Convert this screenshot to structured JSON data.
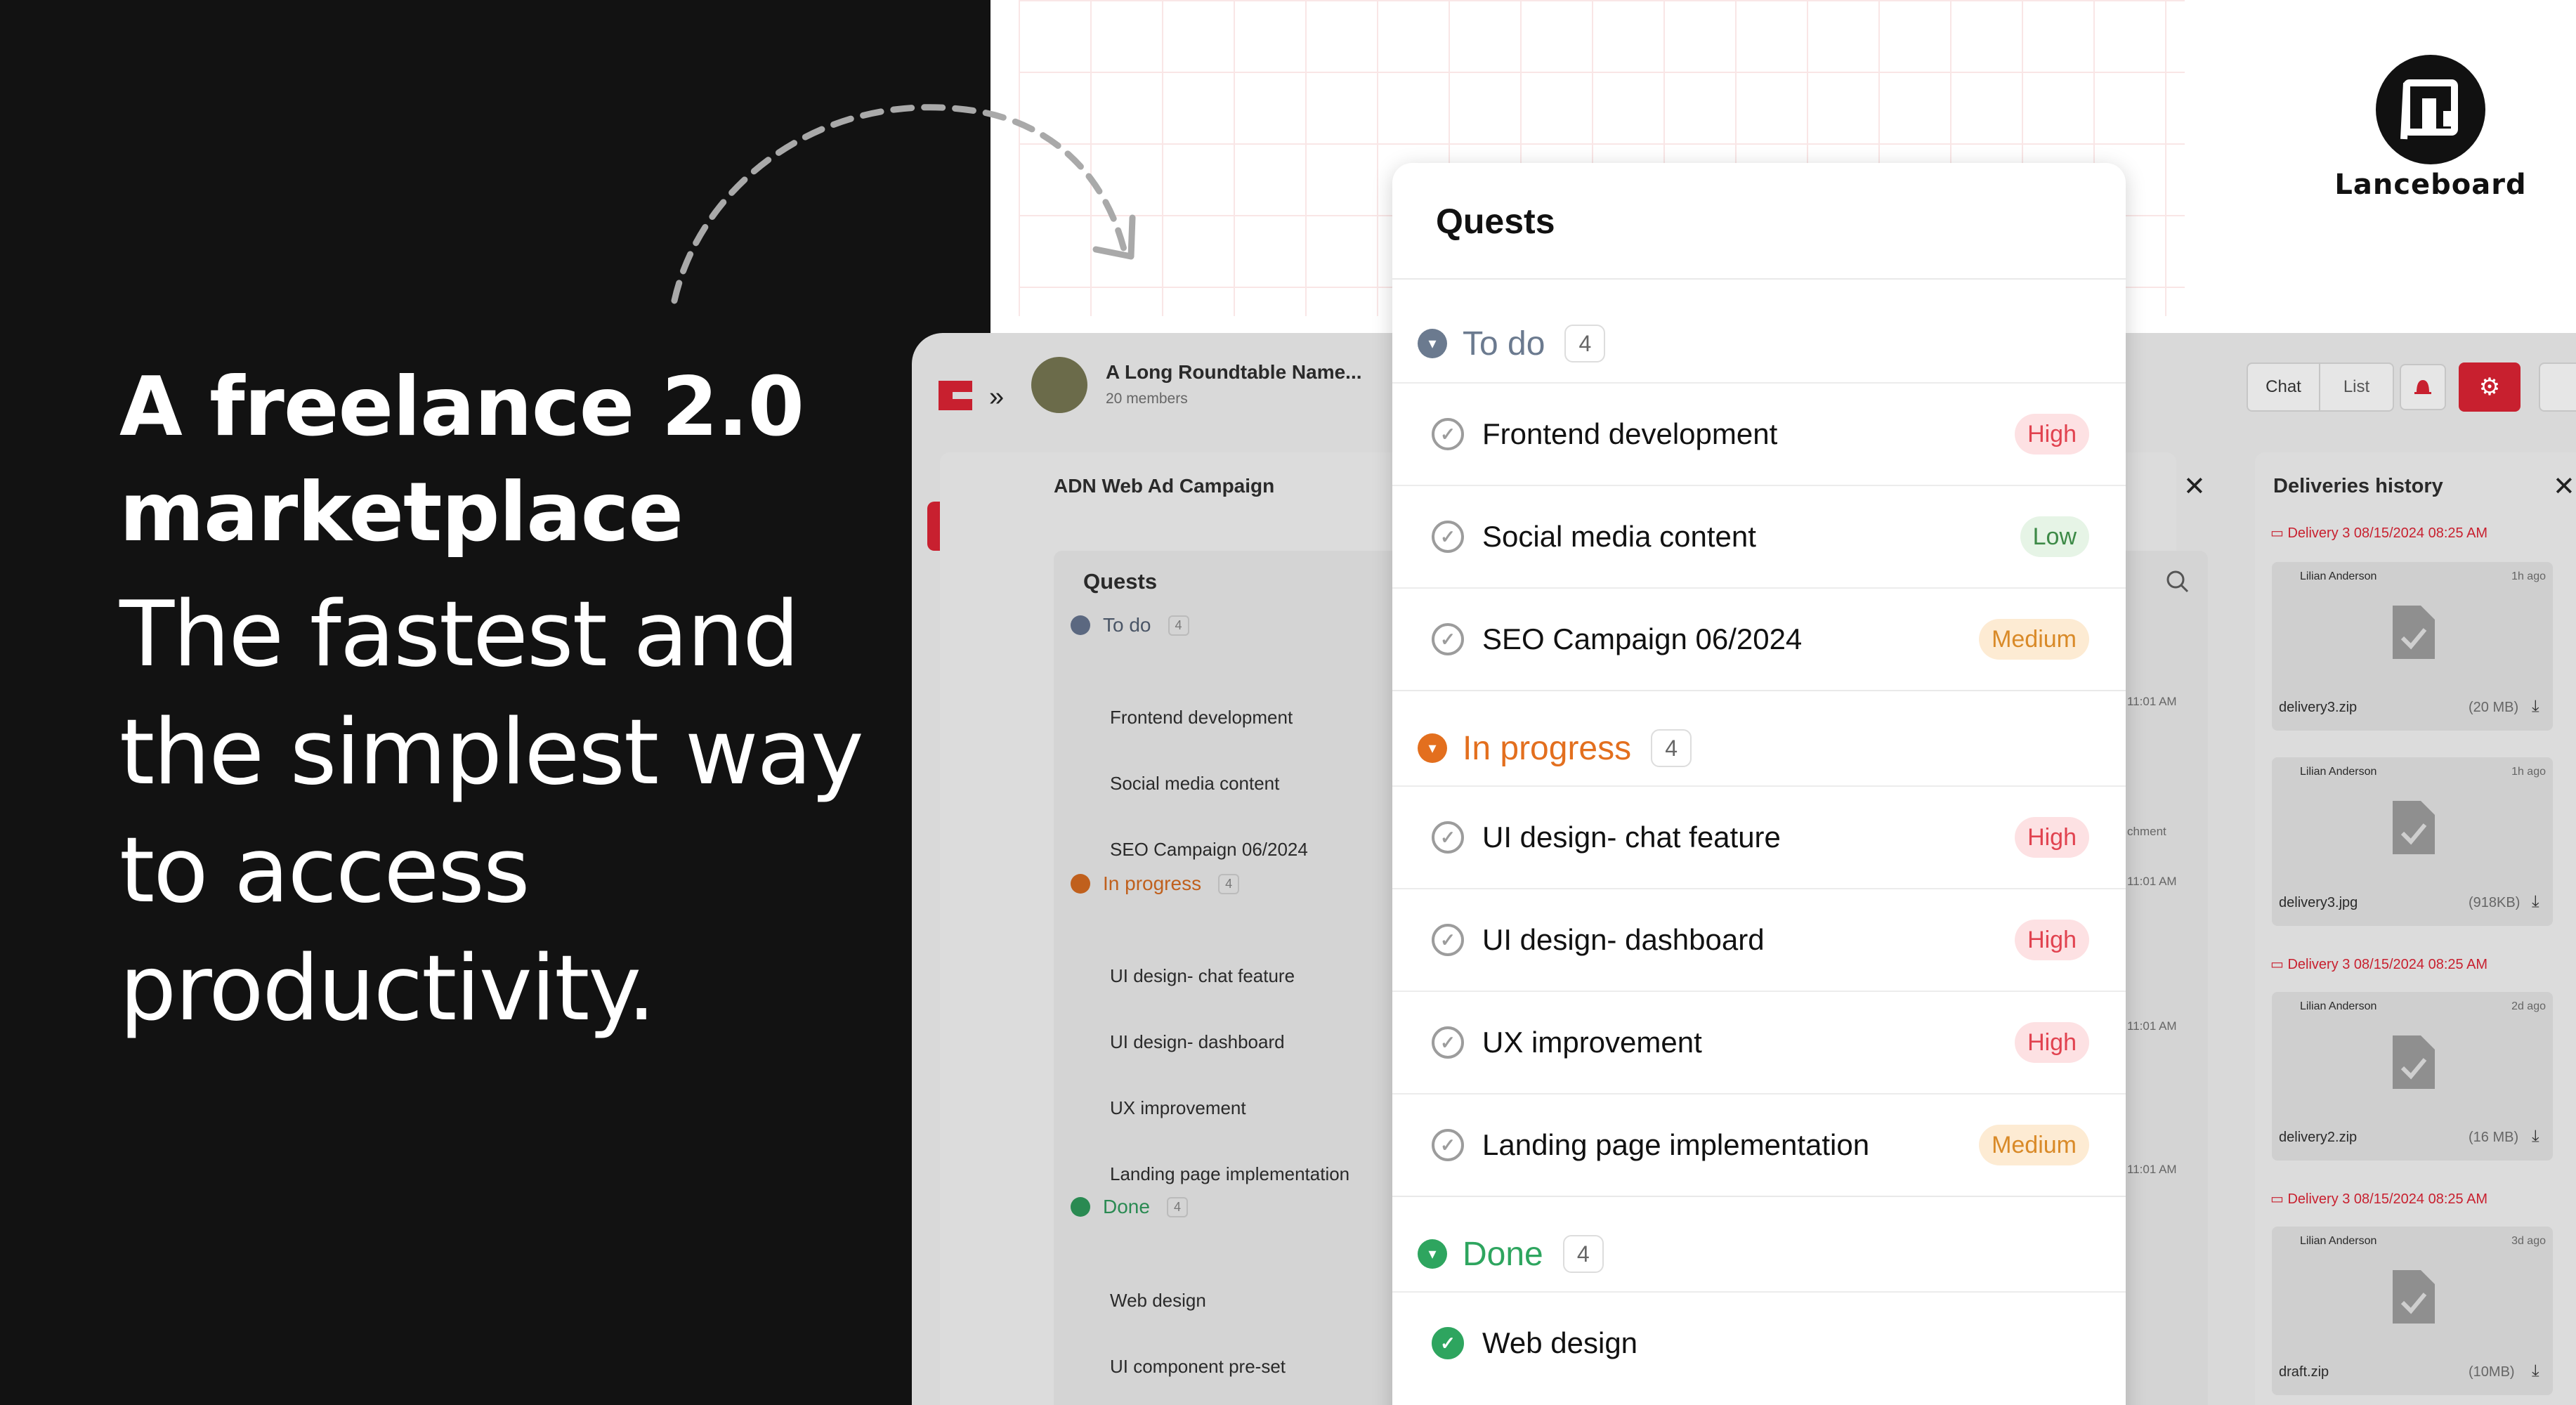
{
  "hero": {
    "bold_line1": "A freelance 2.0",
    "bold_line2": "marketplace",
    "light_line1": "The fastest and",
    "light_line2": "the simplest way",
    "light_line3": "to access",
    "light_line4": "productivity."
  },
  "brand": {
    "name": "Lanceboard"
  },
  "header": {
    "group_name": "A Long Roundtable Name...",
    "members": "20 members",
    "chat_label": "Chat",
    "list_label": "List"
  },
  "project": {
    "title": "ADN Web Ad Campaign"
  },
  "deliveries": {
    "title": "Deliveries history",
    "groups": [
      {
        "label": "Delivery 3 08/15/2024 08:25 AM"
      },
      {
        "label": "Delivery 3 08/15/2024 08:25 AM"
      },
      {
        "label": "Delivery 3 08/15/2024 08:25 AM"
      }
    ],
    "files": [
      {
        "author": "Lilian Anderson",
        "ago": "1h ago",
        "name": "delivery3.zip",
        "size": "(20 MB)"
      },
      {
        "author": "Lilian Anderson",
        "ago": "1h ago",
        "name": "delivery3.jpg",
        "size": "(918KB)"
      },
      {
        "author": "Lilian Anderson",
        "ago": "2d ago",
        "name": "delivery2.zip",
        "size": "(16 MB)"
      },
      {
        "author": "Lilian Anderson",
        "ago": "3d ago",
        "name": "draft.zip",
        "size": "(10MB)"
      }
    ]
  },
  "chat_stubs": {
    "t1": "11:01 AM",
    "t2": "11:01 AM",
    "t3": "11:01 AM",
    "t4": "11:01 AM",
    "attach": "chment"
  },
  "quests_bg": {
    "title": "Quests",
    "todo": {
      "label": "To do",
      "count": "4",
      "items": [
        "Frontend development",
        "Social media content",
        "SEO Campaign 06/2024"
      ]
    },
    "progress": {
      "label": "In progress",
      "count": "4",
      "items": [
        "UI design- chat feature",
        "UI design- dashboard",
        "UX improvement",
        "Landing page implementation"
      ]
    },
    "done": {
      "label": "Done",
      "count": "4",
      "items": [
        "Web design",
        "UI component pre-set"
      ]
    }
  },
  "quests": {
    "title": "Quests",
    "todo": {
      "label": "To do",
      "count": "4",
      "items": [
        {
          "name": "Frontend development",
          "priority": "High"
        },
        {
          "name": "Social media content",
          "priority": "Low"
        },
        {
          "name": "SEO Campaign 06/2024",
          "priority": "Medium"
        }
      ]
    },
    "progress": {
      "label": "In progress",
      "count": "4",
      "items": [
        {
          "name": "UI design- chat feature",
          "priority": "High"
        },
        {
          "name": "UI design- dashboard",
          "priority": "High"
        },
        {
          "name": "UX improvement",
          "priority": "High"
        },
        {
          "name": "Landing page implementation",
          "priority": "Medium"
        }
      ]
    },
    "done": {
      "label": "Done",
      "count": "4",
      "items": [
        {
          "name": "Web design"
        }
      ]
    }
  },
  "colors": {
    "accent_red": "#c8202f",
    "high_bg": "#fde1e3",
    "high_text": "#e1424f",
    "low_bg": "#e6f4e6",
    "low_text": "#3d8a47",
    "medium_bg": "#fdebd3",
    "medium_text": "#d98a28",
    "todo": "#6b7a8f",
    "progress": "#e36f1e",
    "done": "#2ea55f"
  },
  "icons": [
    "arrow-icon",
    "logo-icon",
    "double-chevron-icon",
    "grid-icon",
    "chrome-icon",
    "document-icon",
    "calendar-icon",
    "globe-icon",
    "chat-icon",
    "bell-icon",
    "gear-icon",
    "close-icon",
    "search-icon",
    "folder-icon",
    "file-check-icon",
    "download-icon",
    "check-icon"
  ]
}
